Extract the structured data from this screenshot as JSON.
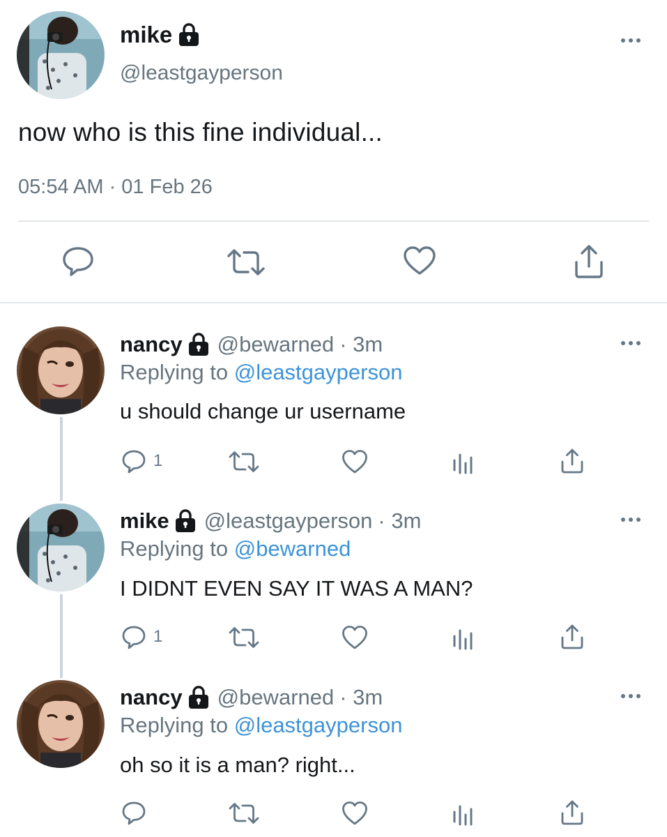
{
  "main_tweet": {
    "display_name": "mike",
    "handle": "@leastgayperson",
    "text": "now who is this fine individual...",
    "timestamp": "05:54 AM · 01 Feb 26",
    "actions": {
      "reply_icon": "reply-icon",
      "retweet_icon": "retweet-icon",
      "like_icon": "like-icon",
      "share_icon": "share-icon"
    }
  },
  "replies": [
    {
      "display_name": "nancy",
      "handle": "@bewarned",
      "time": "· 3m",
      "replying_label": "Replying to",
      "replying_to": "@leastgayperson",
      "text": "u should change ur username",
      "reply_count": "1"
    },
    {
      "display_name": "mike",
      "handle": "@leastgayperson",
      "time": "· 3m",
      "replying_label": "Replying to",
      "replying_to": "@bewarned",
      "text": "I DIDNT EVEN SAY IT WAS A MAN?",
      "reply_count": "1"
    },
    {
      "display_name": "nancy",
      "handle": "@bewarned",
      "time": "· 3m",
      "replying_label": "Replying to",
      "replying_to": "@leastgayperson",
      "text": "oh so it is a man? right...",
      "reply_count": ""
    }
  ],
  "colors": {
    "text": "#14171a",
    "secondary": "#657786",
    "link": "#3d93d8",
    "divider": "#e3e7ea",
    "thread_line": "#cdd5dc"
  }
}
